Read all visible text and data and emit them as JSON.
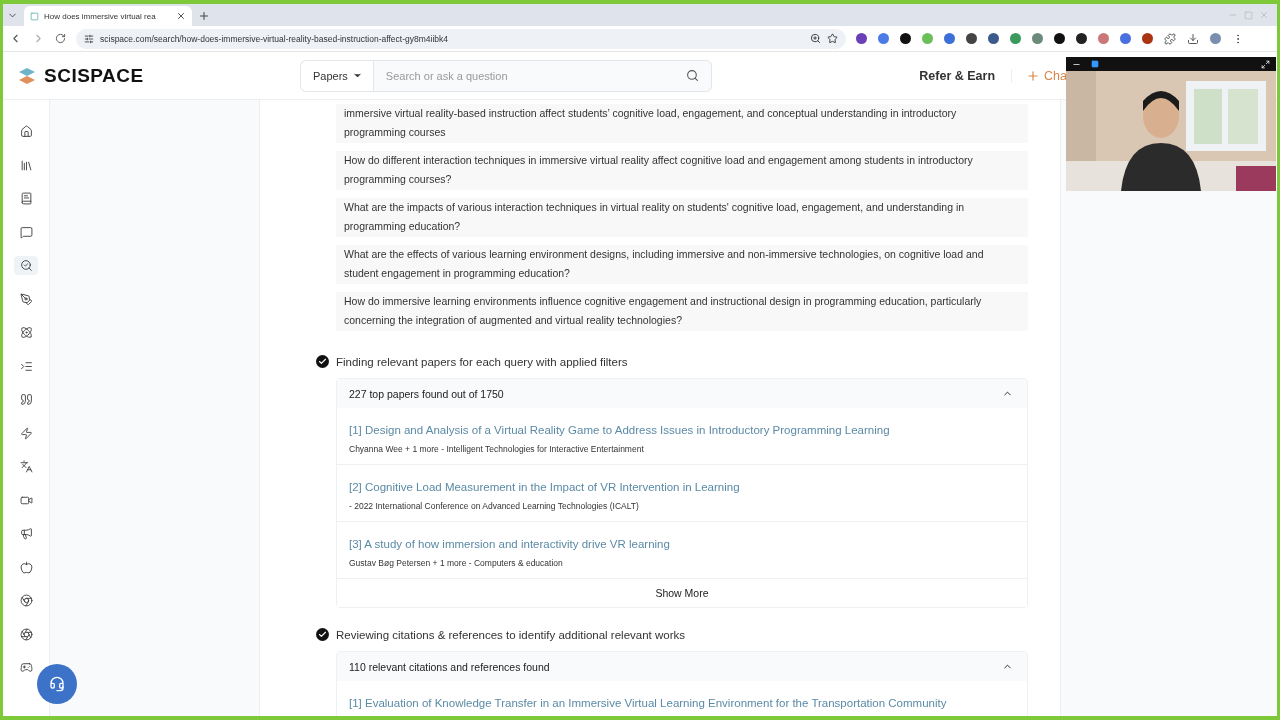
{
  "browser": {
    "tab_title": "How does immersive virtual rea",
    "url": "scispace.com/search/how-does-immersive-virtual-reality-based-instruction-affect-gy8m4iibk4"
  },
  "header": {
    "logo": "SCISPACE",
    "search_mode": "Papers",
    "search_placeholder": "Search or ask a question",
    "refer": "Refer & Earn",
    "chat": "Cha"
  },
  "queries": [
    "immersive virtual reality-based instruction affect students’ cognitive load, engagement, and conceptual understanding in introductory programming courses",
    "How do different interaction techniques in immersive virtual reality affect cognitive load and engagement among students in introductory programming courses?",
    "What are the impacts of various interaction techniques in virtual reality on students' cognitive load, engagement, and understanding in programming education?",
    "What are the effects of various learning environment designs, including immersive and non-immersive technologies, on cognitive load and student engagement in programming education?",
    "How do immersive learning environments influence cognitive engagement and instructional design in programming education, particularly concerning the integration of augmented and virtual reality technologies?"
  ],
  "steps": [
    {
      "title": "Finding relevant papers for each query with applied filters",
      "done": true,
      "summary": "227 top papers found out of 1750",
      "expanded": true,
      "show_more": "Show More",
      "papers": [
        {
          "title": "[1] Design and Analysis of a Virtual Reality Game to Address Issues in Introductory Programming Learning",
          "meta": "Chyanna Wee + 1 more - Intelligent Technologies for Interactive Entertainment"
        },
        {
          "title": "[2] Cognitive Load Measurement in the Impact of VR Intervention in Learning",
          "meta": " - 2022 International Conference on Advanced Learning Technologies (ICALT)"
        },
        {
          "title": "[3] A study of how immersion and interactivity drive VR learning",
          "meta": "Gustav Bøg Petersen + 1 more - Computers & education"
        }
      ]
    },
    {
      "title": "Reviewing citations & references to identify additional relevant works",
      "done": true,
      "summary": "110 relevant citations and references found",
      "expanded": true,
      "papers": [
        {
          "title": "[1] Evaluation of Knowledge Transfer in an Immersive Virtual Learning Environment for the Transportation Community"
        }
      ]
    }
  ]
}
